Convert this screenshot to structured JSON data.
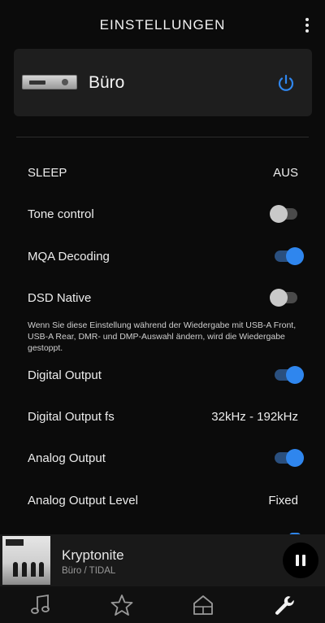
{
  "header": {
    "title": "EINSTELLUNGEN",
    "menu_icon": "more-vert-icon"
  },
  "device": {
    "name": "Büro",
    "image_icon": "audio-device-image",
    "power_icon": "power-icon",
    "accent_color": "#2f86ee"
  },
  "settings": [
    {
      "label": "SLEEP",
      "type": "value",
      "value": "AUS"
    },
    {
      "label": "Tone control",
      "type": "toggle",
      "on": false
    },
    {
      "label": "MQA Decoding",
      "type": "toggle",
      "on": true
    },
    {
      "label": "DSD Native",
      "type": "toggle",
      "on": false
    },
    {
      "label": "Digital Output",
      "type": "toggle",
      "on": true
    },
    {
      "label": "Digital Output fs",
      "type": "value",
      "value": "32kHz - 192kHz"
    },
    {
      "label": "Analog Output",
      "type": "toggle",
      "on": true
    },
    {
      "label": "Analog Output Level",
      "type": "value",
      "value": "Fixed"
    }
  ],
  "dsd_note": "Wenn Sie diese Einstellung während der Wiedergabe mit USB-A Front, USB-A Rear, DMR- und DMP-Auswahl ändern, wird die Wiedergabe gestoppt.",
  "now_playing": {
    "title": "Kryptonite",
    "subtitle": "Büro / TIDAL",
    "control_icon": "pause-icon"
  },
  "bottom_nav": [
    {
      "icon": "music-note-icon"
    },
    {
      "icon": "star-icon"
    },
    {
      "icon": "home-icon"
    },
    {
      "icon": "wrench-icon"
    }
  ]
}
